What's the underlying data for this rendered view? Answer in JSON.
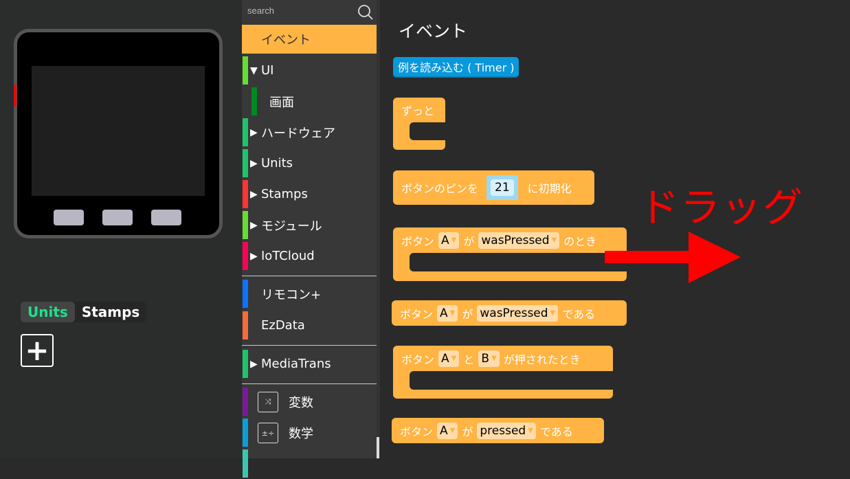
{
  "left_panel": {
    "tabs": [
      {
        "label": "Units"
      },
      {
        "label": "Stamps"
      }
    ],
    "add_button": "+"
  },
  "toolbox": {
    "search_placeholder": "search",
    "categories": [
      {
        "label": "イベント",
        "color": "#ffb444",
        "arrow": ""
      },
      {
        "label": "UI",
        "color": "#66dd33",
        "arrow": "▼"
      },
      {
        "label": "画面",
        "color": "#008822",
        "arrow": ""
      },
      {
        "label": "ハードウェア",
        "color": "#1ec46b",
        "arrow": "▶"
      },
      {
        "label": "Units",
        "color": "#1ec46b",
        "arrow": "▶"
      },
      {
        "label": "Stamps",
        "color": "#ff3333",
        "arrow": "▶"
      },
      {
        "label": "モジュール",
        "color": "#66dd33",
        "arrow": "▶"
      },
      {
        "label": "IoTCloud",
        "color": "#ff0055",
        "arrow": "▶"
      },
      {
        "label": "リモコン+",
        "color": "#0a74ff",
        "arrow": ""
      },
      {
        "label": "EzData",
        "color": "#f56c3c",
        "arrow": ""
      },
      {
        "label": "MediaTrans",
        "color": "#1ec46b",
        "arrow": "▶"
      },
      {
        "label": "変数",
        "color": "#7a1a9a",
        "arrow": ""
      },
      {
        "label": "数学",
        "color": "#0a9fd8",
        "arrow": ""
      }
    ]
  },
  "flyout": {
    "title": "イベント",
    "example_button": "例を読み込む ( Timer )",
    "blocks": {
      "forever": "ずっと",
      "init_pin": {
        "prefix": "ボタンのピンを",
        "value": "21",
        "suffix": "に初期化"
      },
      "when_pressed": {
        "prefix": "ボタン",
        "button": "A",
        "mid": "が",
        "event": "wasPressed",
        "suffix": "のとき"
      },
      "is_pressed": {
        "prefix": "ボタン",
        "button": "A",
        "mid": "が",
        "event": "wasPressed",
        "suffix": "である"
      },
      "ab_pressed": {
        "prefix": "ボタン",
        "button1": "A",
        "mid": "と",
        "button2": "B",
        "suffix": "が押されたとき"
      },
      "pressed": {
        "prefix": "ボタン",
        "button": "A",
        "mid": "が",
        "event": "pressed",
        "suffix": "である"
      }
    }
  },
  "annotation": {
    "text": "ドラッグ",
    "color": "#ff0000"
  }
}
